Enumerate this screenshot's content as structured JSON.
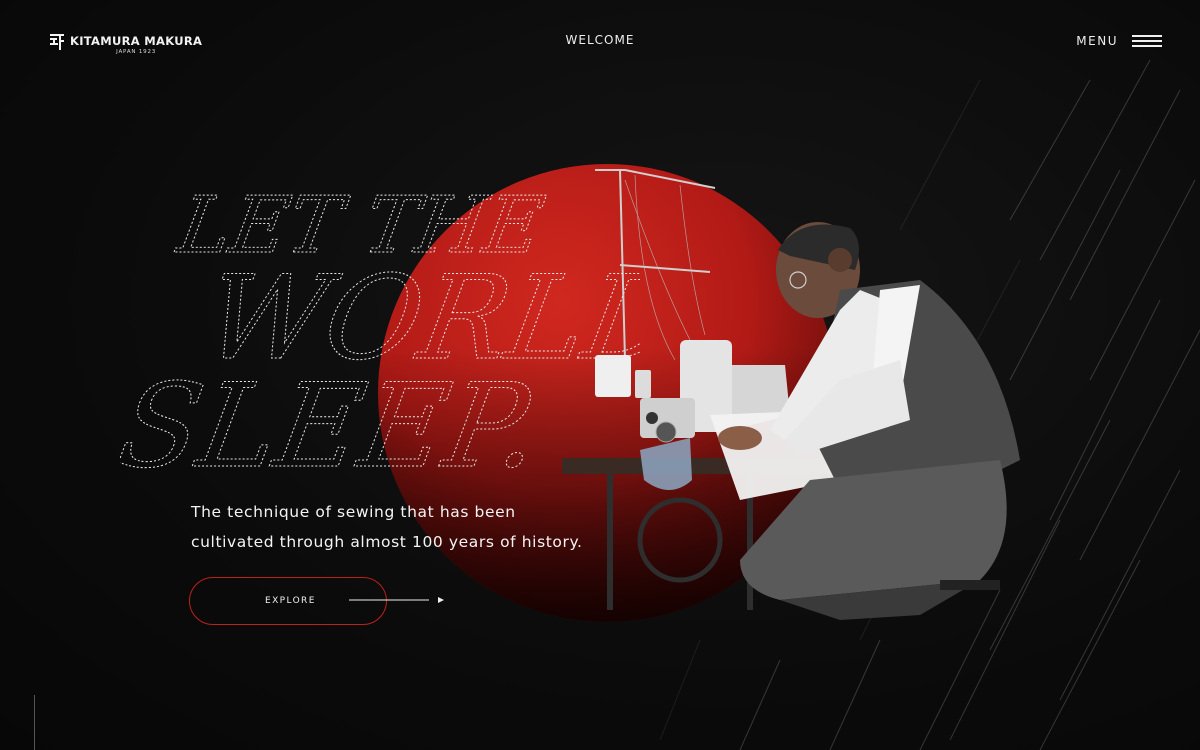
{
  "header": {
    "brand_name": "KITAMURA MAKURA",
    "brand_sub": "JAPAN 1923",
    "center_title": "WELCOME",
    "menu_label": "MENU"
  },
  "hero": {
    "headline_lines": [
      "LET THE",
      "WORLD",
      "SLEEP."
    ],
    "tagline_line1": "The technique of sewing that has been",
    "tagline_line2": "cultivated through almost 100 years of history.",
    "cta_label": "EXPLORE"
  },
  "colors": {
    "background": "#0c0c0c",
    "accent_red": "#c0201a",
    "text": "#f4f4f4"
  },
  "icons": {
    "logo": "kitamura-logo-mark",
    "menu": "hamburger-icon",
    "cta": "arrow-right-icon"
  }
}
